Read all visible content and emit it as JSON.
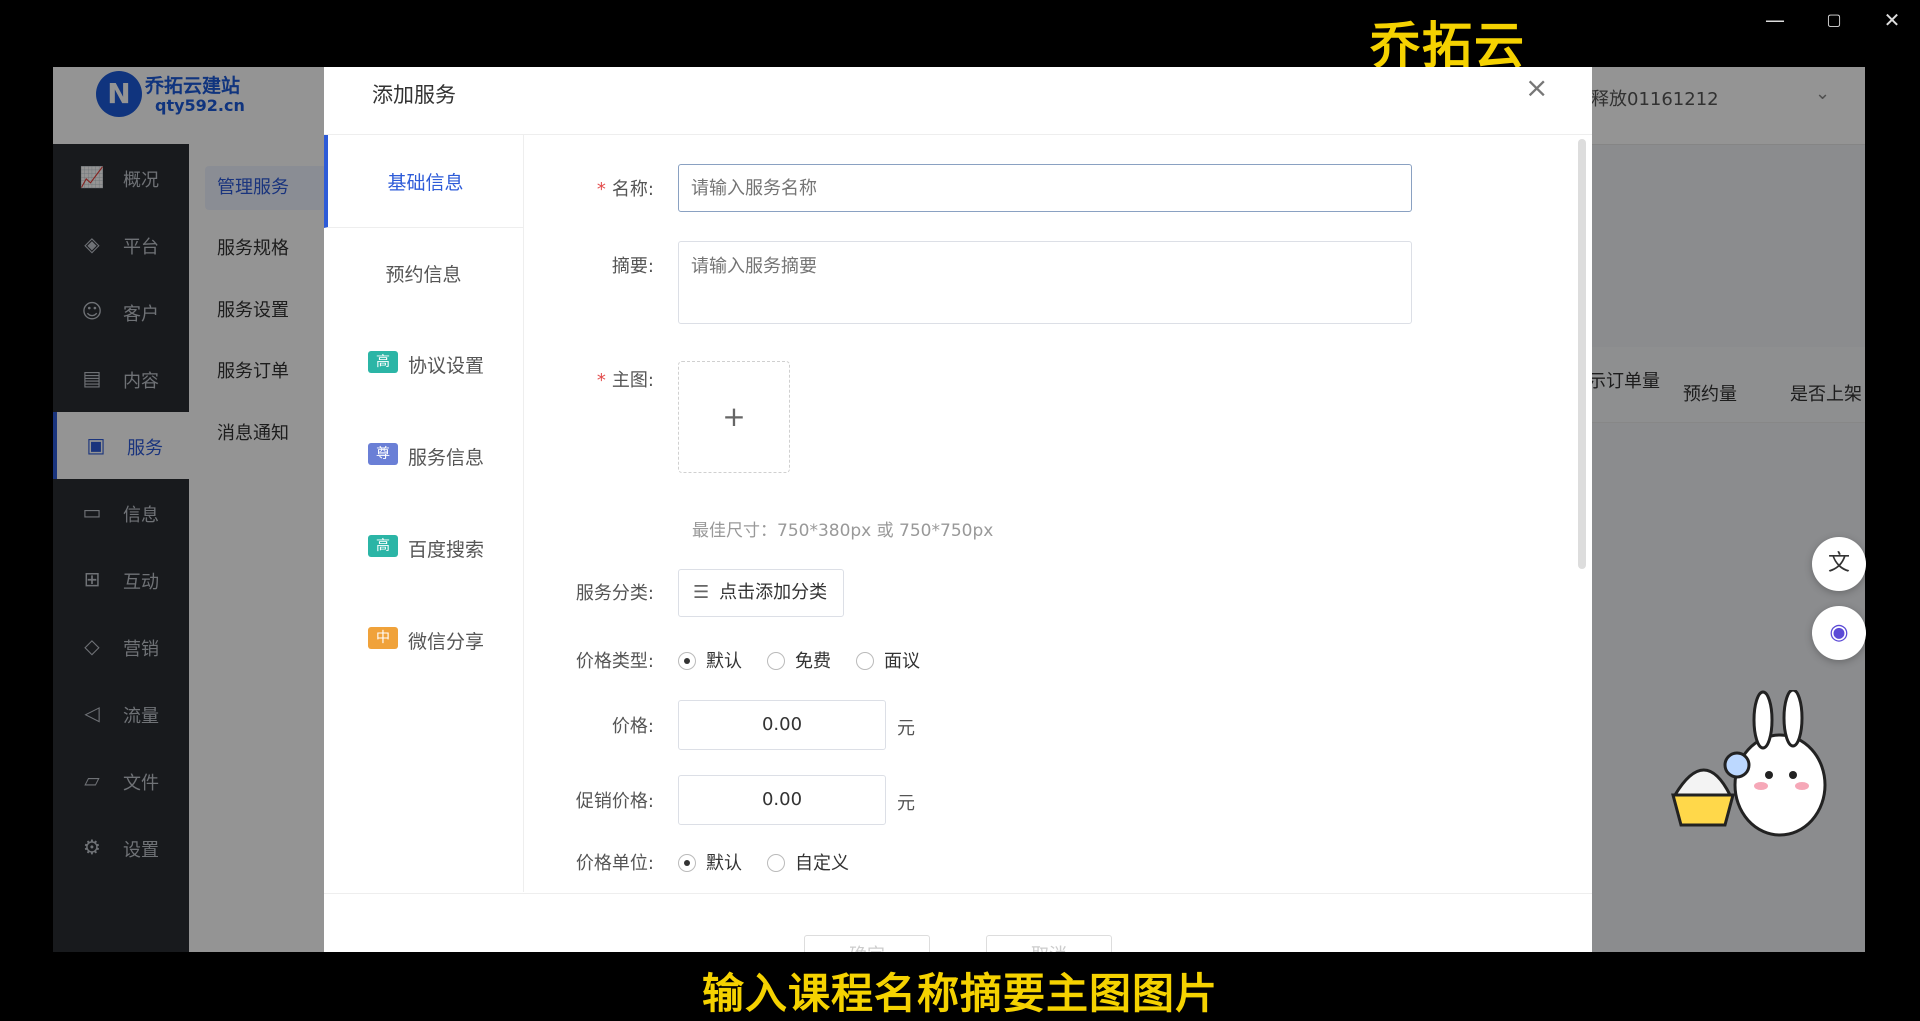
{
  "overlay": {
    "brand_caption": "乔拓云",
    "bottom_caption": "输入课程名称摘要主图图片"
  },
  "window_controls": [
    "—",
    "▢",
    "✕"
  ],
  "app": {
    "logo_mark": "N",
    "logo_name": "乔拓云建站",
    "logo_url": "qty592.cn",
    "user_name": "释放01161212",
    "sidebar": [
      {
        "label": "概况",
        "icon": "chart-icon"
      },
      {
        "label": "平台",
        "icon": "layers-icon"
      },
      {
        "label": "客户",
        "icon": "user-icon"
      },
      {
        "label": "内容",
        "icon": "document-icon"
      },
      {
        "label": "服务",
        "icon": "service-icon",
        "active": true
      },
      {
        "label": "信息",
        "icon": "message-icon"
      },
      {
        "label": "互动",
        "icon": "interact-icon"
      },
      {
        "label": "营销",
        "icon": "tag-icon"
      },
      {
        "label": "流量",
        "icon": "megaphone-icon"
      },
      {
        "label": "文件",
        "icon": "folder-icon"
      },
      {
        "label": "设置",
        "icon": "gear-icon"
      }
    ],
    "subnav": [
      "管理服务",
      "服务规格",
      "服务设置",
      "服务订单",
      "消息通知"
    ],
    "bg_columns": [
      "示订单量",
      "预约量",
      "是否上架"
    ]
  },
  "modal": {
    "title": "添加服务",
    "close": "×",
    "tabs": [
      {
        "label": "基础信息",
        "active": true
      },
      {
        "label": "预约信息"
      },
      {
        "label": "协议设置",
        "badge": "高",
        "badge_color": "#2bb5a6"
      },
      {
        "label": "服务信息",
        "badge": "尊",
        "badge_color": "#6a7fd6"
      },
      {
        "label": "百度搜索",
        "badge": "高",
        "badge_color": "#2bb5a6"
      },
      {
        "label": "微信分享",
        "badge": "中",
        "badge_color": "#f0a23a"
      }
    ],
    "form": {
      "name_label": "名称:",
      "name_placeholder": "请输入服务名称",
      "summary_label": "摘要:",
      "summary_placeholder": "请输入服务摘要",
      "image_label": "主图:",
      "upload_plus": "+",
      "image_hint": "最佳尺寸：750*380px 或 750*750px",
      "category_label": "服务分类:",
      "category_button": "点击添加分类",
      "price_type_label": "价格类型:",
      "price_type_options": [
        "默认",
        "免费",
        "面议"
      ],
      "price_type_selected": "默认",
      "price_label": "价格:",
      "price_value": "0.00",
      "price_unit": "元",
      "promo_label": "促销价格:",
      "promo_value": "0.00",
      "promo_unit": "元",
      "price_unit_label": "价格单位:",
      "price_unit_options": [
        "默认",
        "自定义"
      ],
      "price_unit_selected": "默认"
    },
    "footer": {
      "confirm": "确定",
      "cancel": "取消"
    }
  }
}
